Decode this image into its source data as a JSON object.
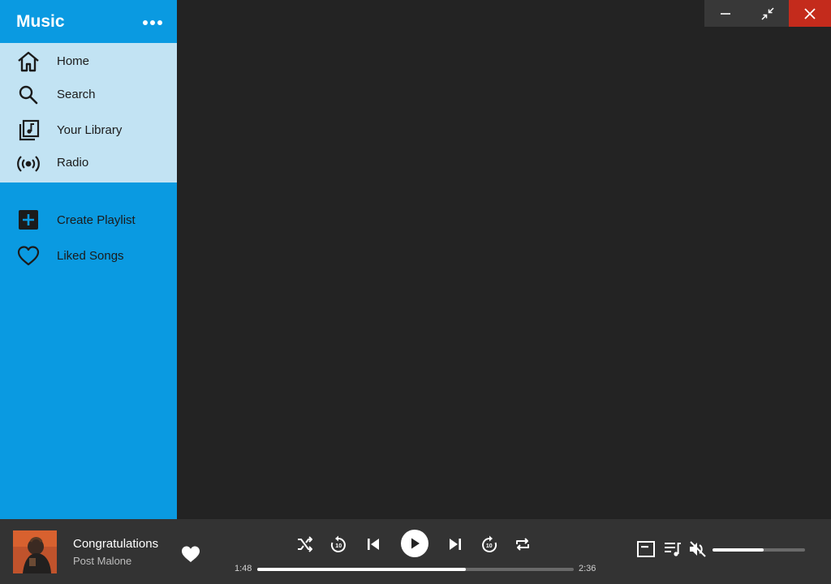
{
  "app": {
    "title": "Music"
  },
  "colors": {
    "sidebar": "#0a9ae1",
    "nav_highlight": "#c2e3f3",
    "content": "#232323",
    "player": "#333333",
    "close": "#c42b1c"
  },
  "sidebar": {
    "more_icon": "more-horizontal-icon",
    "nav": [
      {
        "label": "Home",
        "icon": "home-icon"
      },
      {
        "label": "Search",
        "icon": "search-icon"
      },
      {
        "label": "Your Library",
        "icon": "library-icon"
      },
      {
        "label": "Radio",
        "icon": "radio-icon"
      }
    ],
    "playlists": [
      {
        "label": "Create Playlist",
        "icon": "add-box-icon"
      },
      {
        "label": "Liked Songs",
        "icon": "heart-outline-icon"
      }
    ]
  },
  "window_controls": [
    "minimize-icon",
    "restore-icon",
    "close-icon"
  ],
  "player": {
    "track": {
      "title": "Congratulations",
      "artist": "Post Malone"
    },
    "elapsed": "1:48",
    "duration": "2:36",
    "progress_fraction": 0.66,
    "volume_fraction": 0.55,
    "muted": true
  }
}
